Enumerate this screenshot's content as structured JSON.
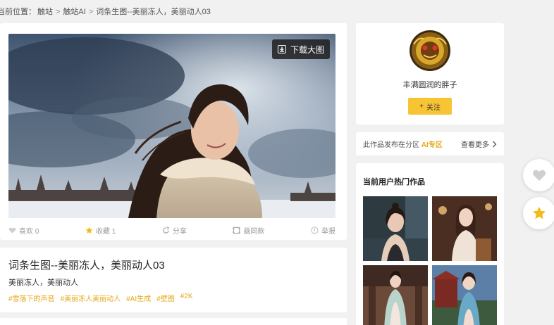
{
  "breadcrumb": {
    "prefix": "当前位置：",
    "items": [
      "触站",
      "触站AI",
      "词条生图--美丽冻人，美丽动人03"
    ]
  },
  "main": {
    "download_label": "下载大图",
    "actions": {
      "like": "喜欢 0",
      "collect": "收藏 1",
      "share": "分享",
      "style": "画同款",
      "report": "举报"
    }
  },
  "work": {
    "title": "词条生图--美丽冻人，美丽动人03",
    "description": "美丽冻人，美丽动人",
    "tags": [
      "#雪落下的声音",
      "#美丽冻人美丽动人",
      "#AI生成",
      "#壁图",
      "#2K"
    ]
  },
  "author": {
    "name": "丰满圆润的胖子",
    "follow_label": "关注"
  },
  "zone": {
    "prefix": "此作品发布在分区",
    "name": "AI专区",
    "more_label": "查看更多"
  },
  "hot": {
    "title": "当前用户热门作品"
  },
  "colors": {
    "accent": "#f7c534",
    "tag": "#e6a817",
    "page_bg": "#f1f1f1"
  },
  "icons": {
    "download": "download-icon",
    "like": "heart-icon",
    "collect": "star-icon",
    "share": "share-icon",
    "style": "frame-icon",
    "report": "info-icon",
    "more": "chevron-right-icon",
    "float_like": "heart-icon",
    "float_collect": "star-icon"
  }
}
